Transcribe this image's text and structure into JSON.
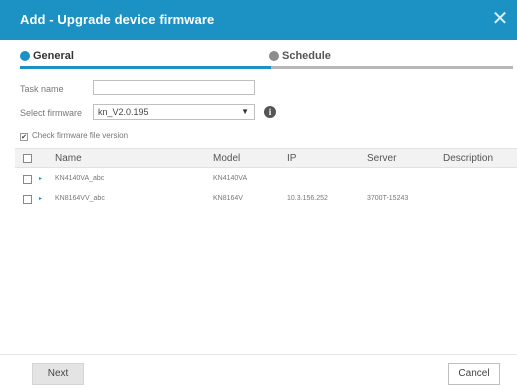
{
  "dialog": {
    "title": "Add - Upgrade device firmware",
    "close_glyph": "✕"
  },
  "steps": [
    {
      "label": "General",
      "active": true
    },
    {
      "label": "Schedule",
      "active": false
    }
  ],
  "form": {
    "task_name_label": "Task name",
    "task_name_value": "",
    "firmware_label": "Select firmware",
    "firmware_value": "kn_V2.0.195",
    "firmware_arrow": "▼",
    "info_glyph": "i",
    "check_label": "Check firmware file version",
    "check_checked": true,
    "check_glyph": "✔"
  },
  "table": {
    "headers": {
      "name": "Name",
      "model": "Model",
      "ip": "IP",
      "server": "Server",
      "description": "Description"
    },
    "rows": [
      {
        "name": "KN4140VA_abc",
        "model": "KN4140VA",
        "ip": "",
        "server": "",
        "description": ""
      },
      {
        "name": "KN8164VV_abc",
        "model": "KN8164V",
        "ip": "10.3.156.252",
        "server": "3700T-15243",
        "description": ""
      }
    ],
    "expander_glyph": "▸"
  },
  "footer": {
    "next_label": "Next",
    "cancel_label": "Cancel"
  },
  "colors": {
    "accent": "#1c92c4",
    "inactive_step": "#8c8c8c"
  }
}
